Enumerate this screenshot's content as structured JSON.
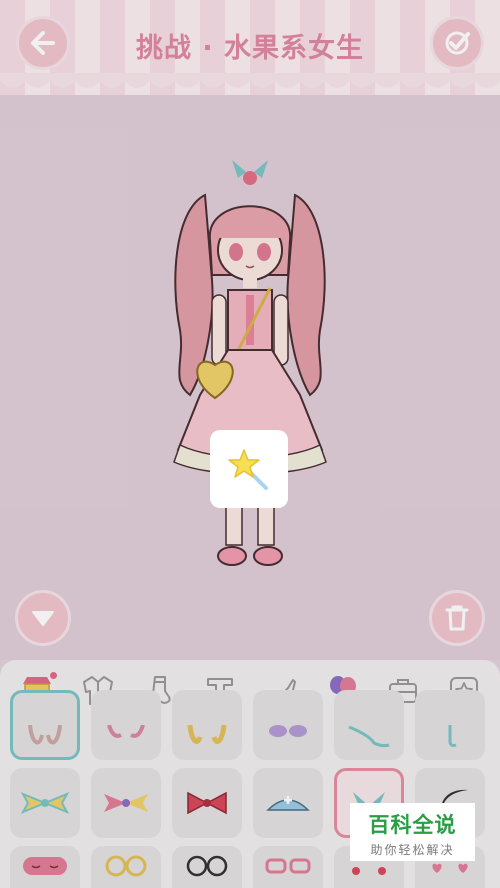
{
  "header": {
    "title": "挑战 · 水果系女生",
    "back_icon": "arrow-left-icon",
    "confirm_icon": "check-icon"
  },
  "stage": {
    "collapse_icon": "triangle-down-icon",
    "trash_icon": "trash-icon",
    "magic_icon": "magic-wand-star-icon"
  },
  "tabs": [
    {
      "name": "shop",
      "icon": "shop-icon",
      "active": true
    },
    {
      "name": "jacket",
      "icon": "jacket-icon"
    },
    {
      "name": "sock",
      "icon": "sock-icon"
    },
    {
      "name": "top",
      "icon": "tshirt-icon"
    },
    {
      "name": "shoes",
      "icon": "high-heel-icon"
    },
    {
      "name": "balloons",
      "icon": "balloons-icon"
    },
    {
      "name": "bag",
      "icon": "bag-icon"
    },
    {
      "name": "favorite",
      "icon": "star-frame-icon"
    }
  ],
  "watermark": {
    "top": "百科全说",
    "bottom": "助你轻松解决"
  },
  "colors": {
    "accent": "#e08aa3",
    "button": "#f3c6cf",
    "panel": "#f2eef0"
  }
}
